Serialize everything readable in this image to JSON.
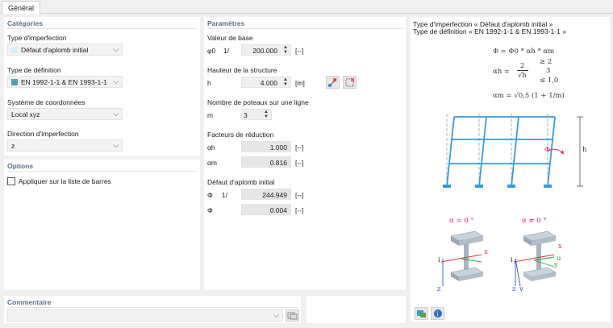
{
  "tabs": [
    {
      "label": "Général"
    }
  ],
  "categories": {
    "title": "Catégories",
    "imperfection_type": {
      "label": "Type d'imperfection",
      "value": "Défaut d'aplomb initial",
      "color": "#d6eef8"
    },
    "definition_type": {
      "label": "Type de définition",
      "value": "EN 1992-1-1 & EN 1993-1-1",
      "color": "#4fa3a8"
    },
    "coordinate_system": {
      "label": "Système de coordonnées",
      "value": "Local xyz"
    },
    "imperfection_direction": {
      "label": "Direction d'imperfection",
      "value": "z"
    }
  },
  "options": {
    "title": "Options",
    "apply_to_members_list": {
      "label": "Appliquer sur la liste de barres",
      "checked": false
    }
  },
  "parameters": {
    "title": "Paramètres",
    "base_value": {
      "label": "Valeur de base",
      "symbol": "φ0",
      "prefix": "1/",
      "value": "200.000",
      "unit": "[--]"
    },
    "structure_height": {
      "label": "Hauteur de la structure",
      "symbol": "h",
      "value": "4.000",
      "unit": "[m]"
    },
    "columns_in_row": {
      "label": "Nombre de poteaux sur une ligne",
      "symbol": "m",
      "value": "3"
    },
    "reduction_factors": {
      "label": "Facteurs de réduction",
      "alpha_h": {
        "symbol": "αh",
        "value": "1.000",
        "unit": "[--]"
      },
      "alpha_m": {
        "symbol": "αm",
        "value": "0.816",
        "unit": "[--]"
      }
    },
    "initial_sway": {
      "label": "Défaut d'aplomb initial",
      "phi_inverse": {
        "symbol": "Φ",
        "prefix": "1/",
        "value": "244.949",
        "unit": "[--]"
      },
      "phi": {
        "symbol": "Φ",
        "value": "0.004",
        "unit": "[--]"
      }
    }
  },
  "comment": {
    "title": "Commentaire",
    "value": ""
  },
  "info": {
    "line1": "Type d'imperfection « Défaut d'aplomb initial »",
    "line2": "Type de définition « EN 1992-1-1 & EN 1993-1-1 »",
    "formula_main": "Φ = Φ0 * αh * αm",
    "formula_alpha_h_lhs": "αh =",
    "formula_alpha_h_frac_num": "2",
    "formula_alpha_h_frac_den": "√h",
    "formula_alpha_h_bound_low": "≥ 2",
    "formula_alpha_h_bound_low_den": "3",
    "formula_alpha_h_bound_high": "≤ 1,0",
    "formula_alpha_m": "αm = √0,5 (1 + 1/m)",
    "frame_height_label": "h",
    "frame_phi_label": "Φ",
    "section_left_label": "α = 0 °",
    "section_right_label": "α ≠ 0 °",
    "axis_x": "x",
    "axis_z": "z",
    "axis_y": "y",
    "axis_v": "v",
    "axis_u": "u",
    "axis_i": "i"
  }
}
